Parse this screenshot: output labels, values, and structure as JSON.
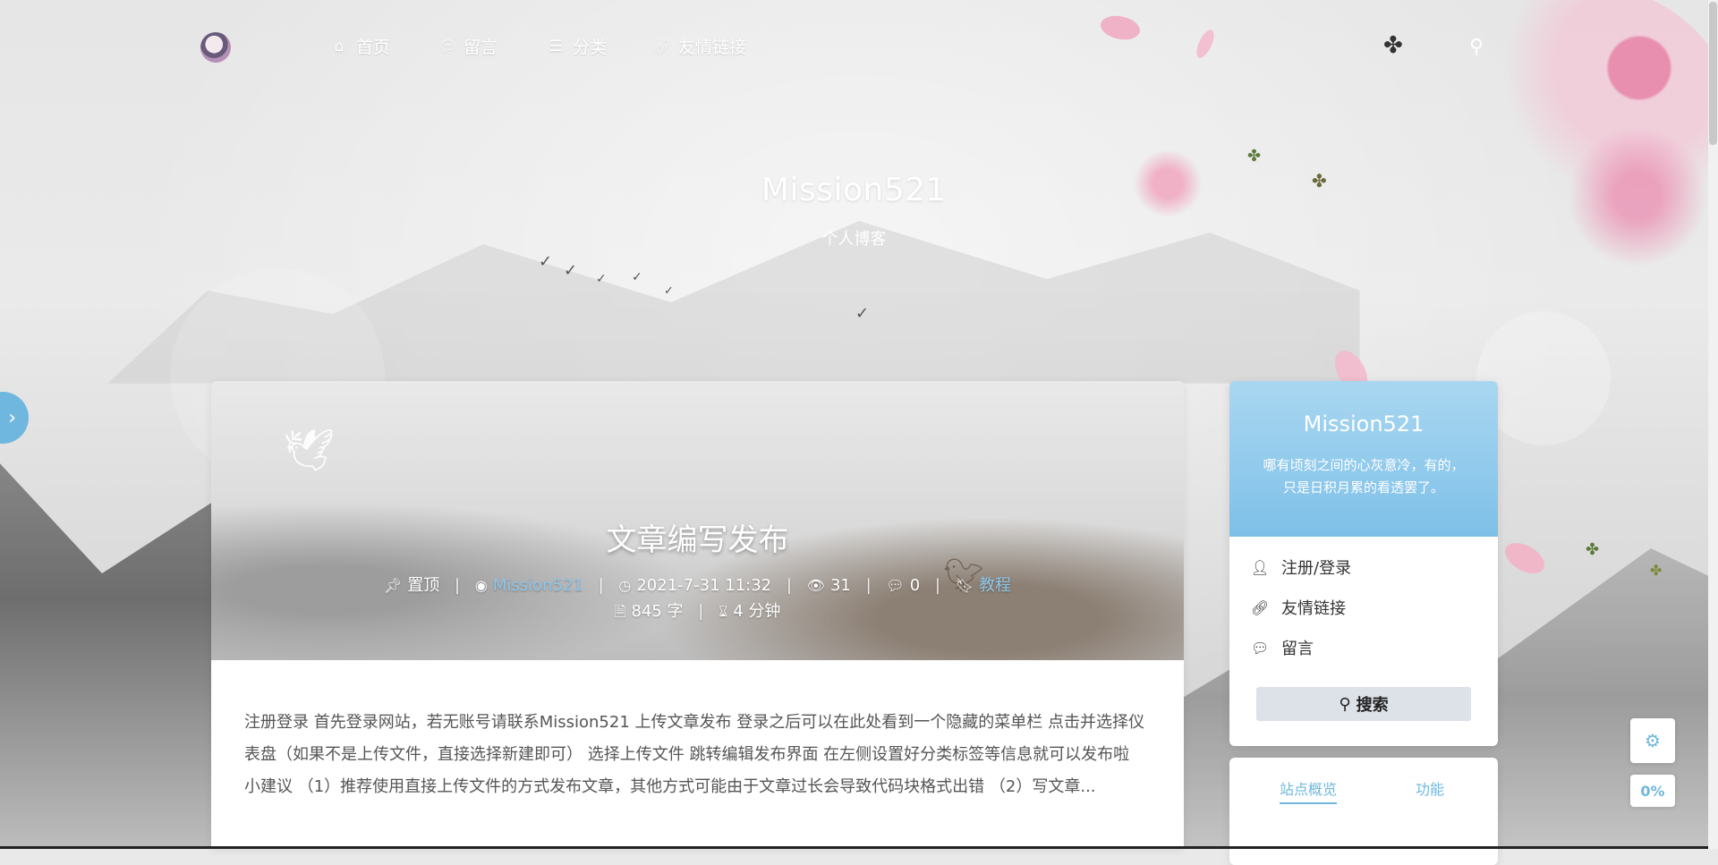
{
  "nav": {
    "items": [
      {
        "label": "首页",
        "icon": "home-icon"
      },
      {
        "label": "留言",
        "icon": "chat-icon"
      },
      {
        "label": "分类",
        "icon": "list-icon"
      },
      {
        "label": "友情链接",
        "icon": "link-icon"
      }
    ],
    "search_icon": "search-icon"
  },
  "hero": {
    "title": "Mission521",
    "subtitle": "个人博客"
  },
  "post": {
    "title": "文章编写发布",
    "meta": {
      "pinned": "置顶",
      "author": "Mission521",
      "date": "2021-7-31 11:32",
      "views": "31",
      "comments": "0",
      "category": "教程",
      "words": "845 字",
      "read_time": "4 分钟"
    },
    "excerpt": "注册登录 首先登录网站，若无账号请联系Mission521 上传文章发布 登录之后可以在此处看到一个隐藏的菜单栏 点击并选择仪表盘（如果不是上传文件，直接选择新建即可） 选择上传文件 跳转编辑发布界面 在左侧设置好分类标签等信息就可以发布啦 小建议 （1）推荐使用直接上传文件的方式发布文章，其他方式可能由于文章过长会导致代码块格式出错 （2）写文章..."
  },
  "profile": {
    "name": "Mission521",
    "motto": "哪有顷刻之间的心灰意冷，有的，只是日积月累的看透罢了。",
    "menu": [
      {
        "label": "注册/登录",
        "icon": "user-icon"
      },
      {
        "label": "友情链接",
        "icon": "link-icon"
      },
      {
        "label": "留言",
        "icon": "chat-icon"
      }
    ],
    "search_button": "搜索"
  },
  "side_tabs": {
    "overview": "站点概览",
    "functions": "功能"
  },
  "float": {
    "progress": "0%"
  },
  "colors": {
    "accent": "#6fb7de",
    "profile_header": "#7ec0e8"
  }
}
